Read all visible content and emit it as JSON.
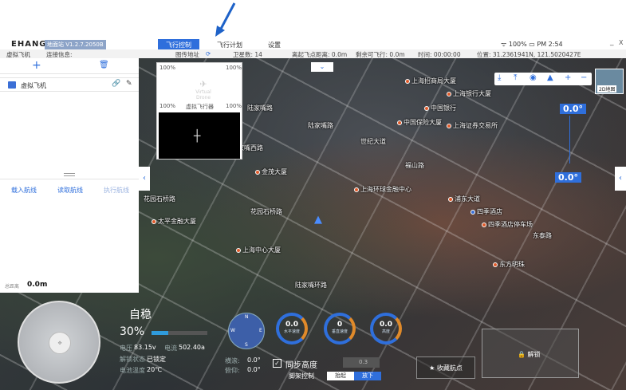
{
  "header": {
    "logo": "EHANG",
    "version": "地面站 V1.2.7.2050B",
    "tabs": [
      "飞行控制",
      "飞行计划",
      "设置"
    ],
    "status": "100%",
    "time": "PM 2:54",
    "minimize": "_",
    "close": "X"
  },
  "infobar": {
    "drone": "虚拟飞机",
    "connection": "连接信息:",
    "map_addr": "图传地址",
    "satellites": "卫星数: 14",
    "takeoff_dist": "离起飞点距离: 0.0m",
    "remaining": "剩余可飞行: 0.0m",
    "time": "时间: 00:00:00",
    "position": "位置: 31.2361941N, 121.5020427E"
  },
  "left_panel": {
    "add": "+",
    "delete": "🗑",
    "drone_name": "虚拟飞机",
    "link_icon": "🔗",
    "edit_icon": "✎",
    "buttons": [
      "载入航线",
      "读取航线",
      "执行航线"
    ],
    "distance_label": "总距离",
    "distance_value": "0.0m"
  },
  "video": {
    "pct_tl": "100%",
    "pct_tr": "100%",
    "pct_bl": "100%",
    "pct_br": "100%",
    "logo_text": "Virtual Drone",
    "camera_label": "虚拟飞行器"
  },
  "map": {
    "labels": [
      "上海招商局大厦",
      "上海银行大厦",
      "中国银行",
      "东方明珠",
      "中国保险大厦",
      "上海证券交易所",
      "世纪大道",
      "陆家嘴路",
      "陆家嘴西路",
      "银城中路",
      "浦东大道",
      "金茂大厦",
      "上海中心大厦",
      "花园石桥路",
      "浦东南路",
      "太平金融大厦",
      "四季酒店",
      "东泰路",
      "上海环球金融中心",
      "陆家嘴环路",
      "福山路",
      "四季酒店停车场"
    ],
    "tools": [
      "⤓",
      "⤒",
      "◉",
      "▲",
      "+",
      "−"
    ],
    "map_2d": "2D地图",
    "alt_top": "0.0°",
    "alt_mid": "0.0°",
    "collapse": "⌄",
    "left_arrow": "‹",
    "right_arrow": "‹"
  },
  "hud": {
    "mode": "自稳",
    "battery_pct": "30%",
    "battery_level": 0.3,
    "voltage_label": "电压",
    "voltage": "83.15v",
    "current_label": "电流",
    "current": "502.40a",
    "lock_label": "解锁状态",
    "lock_state": "已锁定",
    "temp_label": "电池温度",
    "temp": "20℃",
    "pitch_label": "横滚:",
    "pitch": "0.0°",
    "yaw_label": "俯仰:",
    "yaw": "0.0°",
    "gauges": [
      {
        "value": "0.0",
        "label": "水平速度"
      },
      {
        "value": "0",
        "label": "垂直速度"
      },
      {
        "value": "0.0",
        "label": "高度"
      }
    ],
    "compass": [
      "N",
      "S",
      "E",
      "W"
    ],
    "sync_label": "同步高度",
    "sync_value": "0.3",
    "gear_label": "脚架控制",
    "gear_up": "抬起",
    "gear_down": "放下",
    "collect": "★ 收藏航点",
    "unlock": "🔒 解锁"
  },
  "colors": {
    "accent": "#2f6fdc",
    "highlight": "#e08a2a"
  }
}
